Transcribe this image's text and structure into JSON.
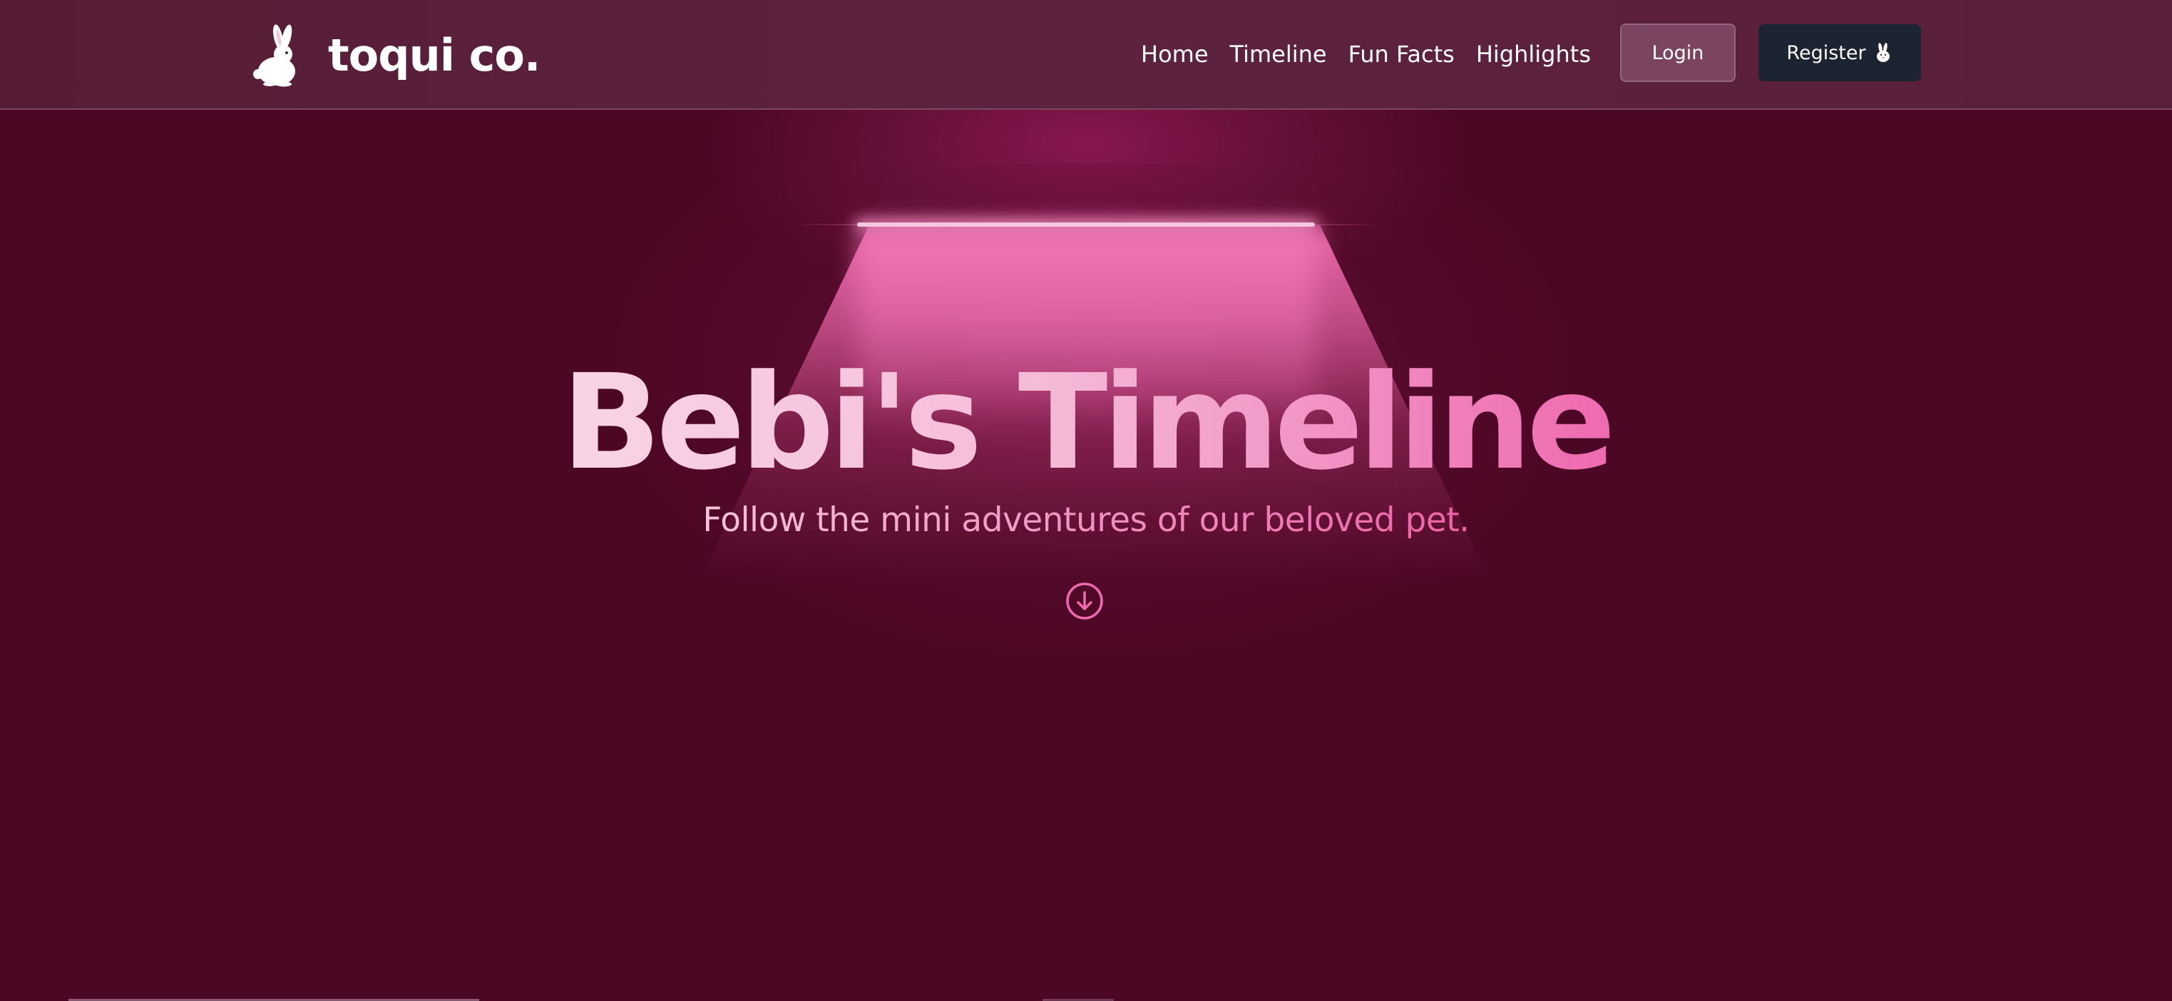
{
  "header": {
    "brand": {
      "name": "toqui co.",
      "logo_icon": "rabbit-icon"
    },
    "nav": [
      {
        "label": "Home"
      },
      {
        "label": "Timeline"
      },
      {
        "label": "Fun Facts"
      },
      {
        "label": "Highlights"
      }
    ],
    "login_label": "Login",
    "register_label": "Register",
    "register_icon": "rabbit-icon"
  },
  "hero": {
    "title": "Bebi's Timeline",
    "subtitle": "Follow the mini adventures of our beloved pet.",
    "scroll_icon": "arrow-down-circle-icon"
  },
  "colors": {
    "background": "#4c0724",
    "header_background": "#5a1f3a",
    "accent_pink": "#ee6aaf",
    "register_button": "#1d2431",
    "login_button": "#7b4460"
  }
}
